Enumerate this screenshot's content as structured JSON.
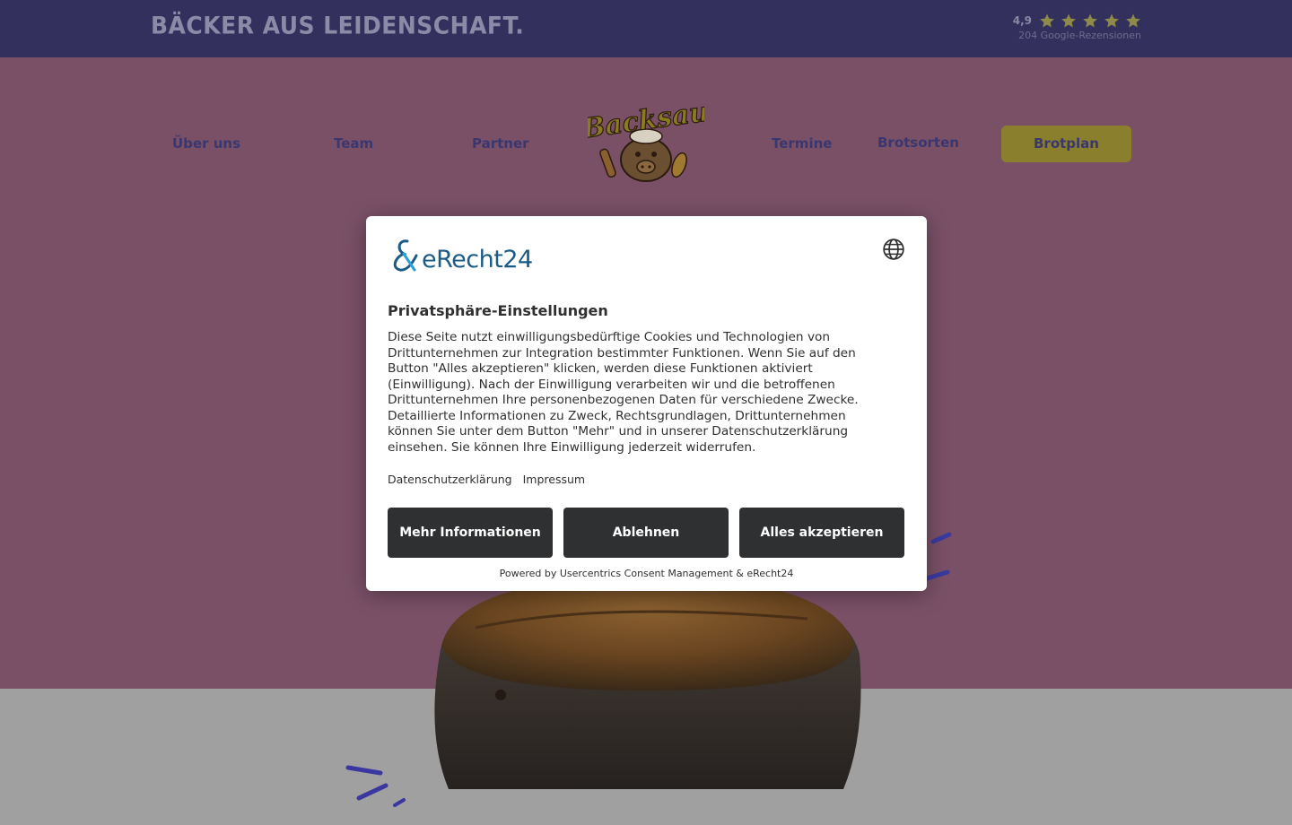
{
  "topbar": {
    "tagline": "BÄCKER AUS LEIDENSCHAFT.",
    "rating_value": "4,9",
    "rating_count": "204 Google-Rezensionen",
    "stars": 5
  },
  "nav": {
    "about": "Über uns",
    "team": "Team",
    "partner": "Partner",
    "termine": "Termine",
    "brotsorten": "Brotsorten",
    "brotplan": "Brotplan"
  },
  "logo": {
    "text": "Backsau"
  },
  "consent": {
    "brand": "eRecht24",
    "title": "Privatsphäre-Einstellungen",
    "description": "Diese Seite nutzt einwilligungsbedürftige Cookies und Technologien von Drittunternehmen zur Integration bestimmter Funktionen. Wenn Sie auf den Button \"Alles akzeptieren\" klicken, werden diese Funktionen aktiviert (Einwilligung). Nach der Einwilligung verarbeiten wir und die betroffenen Drittunternehmen Ihre personenbezogenen Daten für verschiedene Zwecke. Detaillierte Informationen zu Zweck, Rechtsgrundlagen, Drittunternehmen können Sie unter dem Button \"Mehr\" und in unserer Datenschutzerklärung einsehen. Sie können Ihre Einwilligung jederzeit widerrufen.",
    "link_privacy": "Datenschutzerklärung",
    "link_imprint": "Impressum",
    "btn_more": "Mehr Informationen",
    "btn_deny": "Ablehnen",
    "btn_accept": "Alles akzeptieren",
    "powered_by": "Powered by Usercentrics Consent Management & eRecht24"
  },
  "colors": {
    "topbar": "#33305e",
    "hero": "#7a5066",
    "nav_text": "#3a3770",
    "cta": "#8a7f2c",
    "modal_button": "#2f3032",
    "brand": "#1b5c86"
  }
}
